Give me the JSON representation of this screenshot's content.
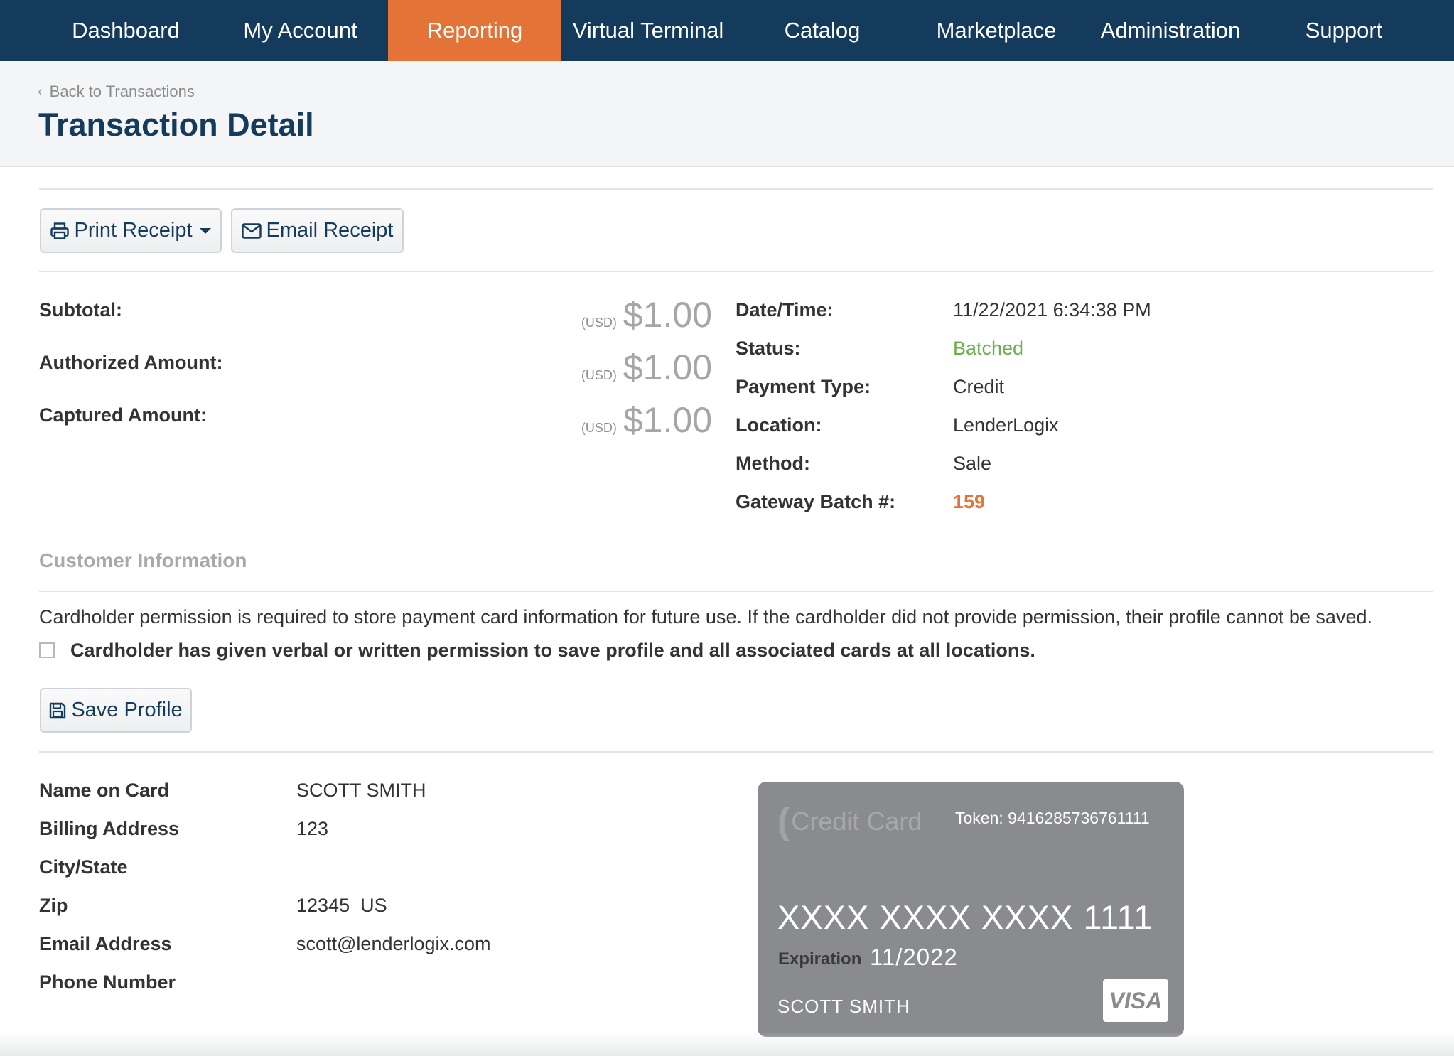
{
  "nav": {
    "items": [
      "Dashboard",
      "My Account",
      "Reporting",
      "Virtual Terminal",
      "Catalog",
      "Marketplace",
      "Administration",
      "Support"
    ],
    "active": "Reporting"
  },
  "header": {
    "back_label": "Back to Transactions",
    "title": "Transaction Detail"
  },
  "actions": {
    "print_receipt": "Print Receipt",
    "email_receipt": "Email Receipt"
  },
  "amounts": [
    {
      "label": "Subtotal:",
      "currency": "(USD)",
      "value": "$1.00"
    },
    {
      "label": "Authorized Amount:",
      "currency": "(USD)",
      "value": "$1.00"
    },
    {
      "label": "Captured Amount:",
      "currency": "(USD)",
      "value": "$1.00"
    }
  ],
  "details": [
    {
      "label": "Date/Time:",
      "value": "11/22/2021 6:34:38 PM"
    },
    {
      "label": "Status:",
      "value": "Batched"
    },
    {
      "label": "Payment Type:",
      "value": "Credit"
    },
    {
      "label": "Location:",
      "value": "LenderLogix"
    },
    {
      "label": "Method:",
      "value": "Sale"
    },
    {
      "label": "Gateway Batch #:",
      "value": "159"
    }
  ],
  "customer": {
    "section_title": "Customer Information",
    "notice": "Cardholder permission is required to store payment card information for future use. If the cardholder did not provide permission, their profile cannot be saved.",
    "permission_label": "Cardholder has given verbal or written permission to save profile and all associated cards at all locations.",
    "permission_checked": false,
    "save_profile": "Save Profile",
    "fields": [
      {
        "label": "Name on Card",
        "value": "SCOTT SMITH"
      },
      {
        "label": "Billing Address",
        "value": "123"
      },
      {
        "label": "City/State",
        "value": ""
      },
      {
        "label": "Zip",
        "value": "12345  US"
      },
      {
        "label": "Email Address",
        "value": "scott@lenderlogix.com"
      },
      {
        "label": "Phone Number",
        "value": ""
      }
    ]
  },
  "card": {
    "logo_text": "Credit Card",
    "token": "Token: 9416285736761111",
    "number": "XXXX XXXX XXXX 1111",
    "expiration_label": "Expiration",
    "expiration": "11/2022",
    "holder": "SCOTT SMITH",
    "brand": "VISA"
  },
  "colors": {
    "nav_bg": "#143a5c",
    "nav_active": "#e37336",
    "status_green": "#6ab04c",
    "batch_orange": "#e37336",
    "card_bg": "#8a8b8e"
  }
}
